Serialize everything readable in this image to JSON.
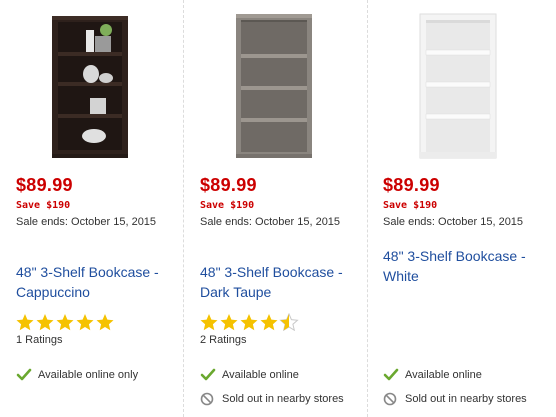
{
  "products": [
    {
      "price": "$89.99",
      "save": "Save $190",
      "sale_ends": "Sale ends: October 15, 2015",
      "title": "48\" 3-Shelf Bookcase - Cappuccino",
      "rating_stars": 5,
      "ratings": "1 Ratings",
      "availability": "Available online only",
      "color": "#2e211c"
    },
    {
      "price": "$89.99",
      "save": "Save $190",
      "sale_ends": "Sale ends: October 15, 2015",
      "title": "48\" 3-Shelf Bookcase - Dark Taupe",
      "rating_stars": 4.5,
      "ratings": "2 Ratings",
      "availability": "Available online",
      "store_status": "Sold out in nearby stores",
      "color": "#7d7872"
    },
    {
      "price": "$89.99",
      "save": "Save $190",
      "sale_ends": "Sale ends: October 15, 2015",
      "title": "48\" 3-Shelf Bookcase - White",
      "availability": "Available online",
      "store_status": "Sold out in nearby stores",
      "color": "#f4f4f4"
    }
  ],
  "colors": {
    "price": "#cc0000",
    "link": "#1f4e9e",
    "star": "#f5c200",
    "check": "#6aa82f",
    "soldout": "#888888"
  },
  "icons": [
    "check-icon",
    "no-entry-icon",
    "star-icon"
  ]
}
